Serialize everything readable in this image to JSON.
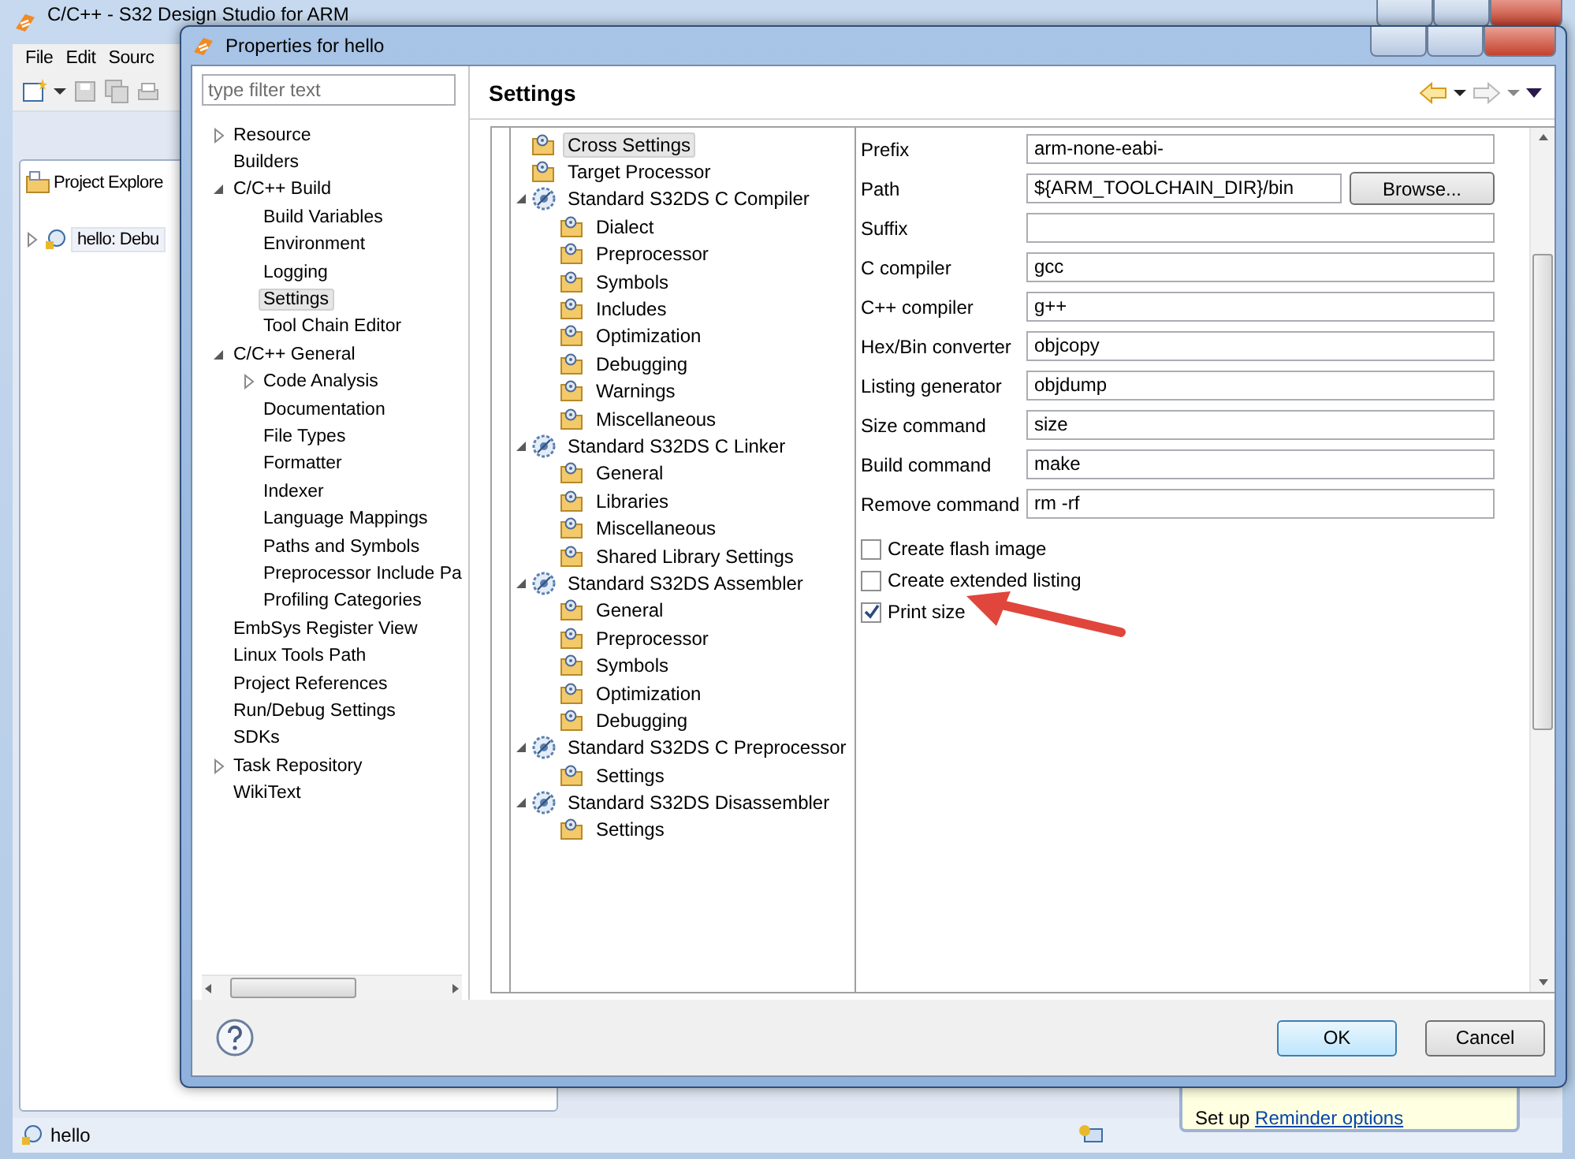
{
  "main_window": {
    "title": "C/C++ - S32 Design Studio for ARM",
    "menu": [
      "File",
      "Edit",
      "Sourc"
    ],
    "view_tab": "Project Explore",
    "project_item": {
      "label": "hello: Debu",
      "expanded": false
    },
    "status_bar": "hello",
    "reminder": {
      "text": "Set up",
      "link": "Reminder options"
    }
  },
  "dialog": {
    "title": "Properties for hello",
    "filter": {
      "placeholder": "type filter text"
    },
    "nav": [
      {
        "label": "Resource",
        "expanded": false,
        "selected": false
      },
      {
        "label": "Builders",
        "selected": false
      },
      {
        "label": "C/C++ Build",
        "expanded": true,
        "selected": false,
        "children": [
          {
            "label": "Build Variables",
            "selected": false
          },
          {
            "label": "Environment",
            "selected": false
          },
          {
            "label": "Logging",
            "selected": false
          },
          {
            "label": "Settings",
            "selected": true
          },
          {
            "label": "Tool Chain Editor",
            "selected": false
          }
        ]
      },
      {
        "label": "C/C++ General",
        "expanded": true,
        "selected": false,
        "children": [
          {
            "label": "Code Analysis",
            "expanded": false,
            "selected": false
          },
          {
            "label": "Documentation",
            "selected": false
          },
          {
            "label": "File Types",
            "selected": false
          },
          {
            "label": "Formatter",
            "selected": false
          },
          {
            "label": "Indexer",
            "selected": false
          },
          {
            "label": "Language Mappings",
            "selected": false
          },
          {
            "label": "Paths and Symbols",
            "selected": false
          },
          {
            "label": "Preprocessor Include Pa",
            "selected": false
          },
          {
            "label": "Profiling Categories",
            "selected": false
          }
        ]
      },
      {
        "label": "EmbSys Register View",
        "selected": false
      },
      {
        "label": "Linux Tools Path",
        "selected": false
      },
      {
        "label": "Project References",
        "selected": false
      },
      {
        "label": "Run/Debug Settings",
        "selected": false
      },
      {
        "label": "SDKs",
        "selected": false
      },
      {
        "label": "Task Repository",
        "expanded": false,
        "selected": false
      },
      {
        "label": "WikiText",
        "selected": false
      }
    ],
    "page_title": "Settings",
    "tool_tree": [
      {
        "label": "Cross Settings",
        "kind": "option",
        "selected": true
      },
      {
        "label": "Target Processor",
        "kind": "option",
        "selected": false
      },
      {
        "label": "Standard S32DS C Compiler",
        "kind": "tool",
        "expanded": true,
        "selected": false,
        "children": [
          {
            "label": "Dialect",
            "kind": "option",
            "selected": false
          },
          {
            "label": "Preprocessor",
            "kind": "option",
            "selected": false
          },
          {
            "label": "Symbols",
            "kind": "option",
            "selected": false
          },
          {
            "label": "Includes",
            "kind": "option",
            "selected": false
          },
          {
            "label": "Optimization",
            "kind": "option",
            "selected": false
          },
          {
            "label": "Debugging",
            "kind": "option",
            "selected": false
          },
          {
            "label": "Warnings",
            "kind": "option",
            "selected": false
          },
          {
            "label": "Miscellaneous",
            "kind": "option",
            "selected": false
          }
        ]
      },
      {
        "label": "Standard S32DS C Linker",
        "kind": "tool",
        "expanded": true,
        "selected": false,
        "children": [
          {
            "label": "General",
            "kind": "option",
            "selected": false
          },
          {
            "label": "Libraries",
            "kind": "option",
            "selected": false
          },
          {
            "label": "Miscellaneous",
            "kind": "option",
            "selected": false
          },
          {
            "label": "Shared Library Settings",
            "kind": "option",
            "selected": false
          }
        ]
      },
      {
        "label": "Standard S32DS Assembler",
        "kind": "tool",
        "expanded": true,
        "selected": false,
        "children": [
          {
            "label": "General",
            "kind": "option",
            "selected": false
          },
          {
            "label": "Preprocessor",
            "kind": "option",
            "selected": false
          },
          {
            "label": "Symbols",
            "kind": "option",
            "selected": false
          },
          {
            "label": "Optimization",
            "kind": "option",
            "selected": false
          },
          {
            "label": "Debugging",
            "kind": "option",
            "selected": false
          }
        ]
      },
      {
        "label": "Standard S32DS C Preprocessor",
        "kind": "tool",
        "expanded": true,
        "selected": false,
        "children": [
          {
            "label": "Settings",
            "kind": "option",
            "selected": false
          }
        ]
      },
      {
        "label": "Standard S32DS Disassembler",
        "kind": "tool",
        "expanded": true,
        "selected": false,
        "children": [
          {
            "label": "Settings",
            "kind": "option",
            "selected": false
          }
        ]
      }
    ],
    "fields": [
      {
        "label": "Prefix",
        "value": "arm-none-eabi-"
      },
      {
        "label": "Path",
        "value": "${ARM_TOOLCHAIN_DIR}/bin",
        "button": "Browse..."
      },
      {
        "label": "Suffix"
      },
      {
        "label": "C compiler",
        "value": "gcc"
      },
      {
        "label": "C++ compiler",
        "value": "g++"
      },
      {
        "label": "Hex/Bin converter",
        "value": "objcopy"
      },
      {
        "label": "Listing generator",
        "value": "objdump"
      },
      {
        "label": "Size command",
        "value": "size"
      },
      {
        "label": "Build command",
        "value": "make"
      },
      {
        "label": "Remove command",
        "value": "rm -rf"
      }
    ],
    "checkboxes": [
      {
        "label": "Create flash image",
        "checked": false
      },
      {
        "label": "Create extended listing",
        "checked": false
      },
      {
        "label": "Print size",
        "checked": true
      }
    ],
    "buttons": [
      {
        "label": "OK",
        "default": true
      },
      {
        "label": "Cancel",
        "default": false
      }
    ]
  }
}
